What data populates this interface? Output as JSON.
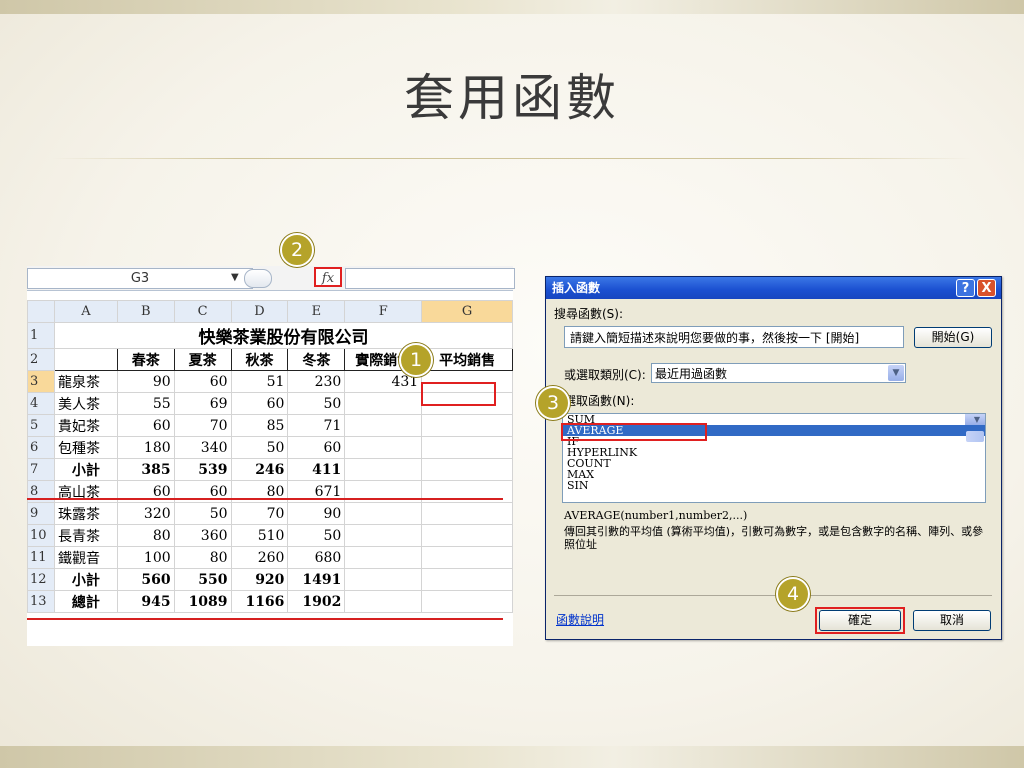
{
  "slide": {
    "title": "套用函數",
    "badges": [
      "1",
      "2",
      "3",
      "4"
    ]
  },
  "spreadsheet": {
    "name_box": "G3",
    "fx_label": "fx",
    "columns": [
      "A",
      "B",
      "C",
      "D",
      "E",
      "F",
      "G"
    ],
    "row_numbers": [
      "1",
      "2",
      "3",
      "4",
      "5",
      "6",
      "7",
      "8",
      "9",
      "10",
      "11",
      "12",
      "13"
    ],
    "company_title": "快樂茶業股份有限公司",
    "headers": [
      "",
      "春茶",
      "夏茶",
      "秋茶",
      "冬茶",
      "實際銷售",
      "平均銷售"
    ],
    "rows": [
      [
        "龍泉茶",
        "90",
        "60",
        "51",
        "230",
        "431",
        ""
      ],
      [
        "美人茶",
        "55",
        "69",
        "60",
        "50",
        "",
        ""
      ],
      [
        "貴妃茶",
        "60",
        "70",
        "85",
        "71",
        "",
        ""
      ],
      [
        "包種茶",
        "180",
        "340",
        "50",
        "60",
        "",
        ""
      ],
      [
        "小計",
        "385",
        "539",
        "246",
        "411",
        "",
        ""
      ],
      [
        "高山茶",
        "60",
        "60",
        "80",
        "671",
        "",
        ""
      ],
      [
        "珠露茶",
        "320",
        "50",
        "70",
        "90",
        "",
        ""
      ],
      [
        "長青茶",
        "80",
        "360",
        "510",
        "50",
        "",
        ""
      ],
      [
        "鐵觀音",
        "100",
        "80",
        "260",
        "680",
        "",
        ""
      ],
      [
        "小計",
        "560",
        "550",
        "920",
        "1491",
        "",
        ""
      ],
      [
        "總計",
        "945",
        "1089",
        "1166",
        "1902",
        "",
        ""
      ]
    ]
  },
  "dialog": {
    "title": "插入函數",
    "help_btn": "?",
    "close_btn": "X",
    "search_label": "搜尋函數(S):",
    "search_value": "請鍵入簡短描述來說明您要做的事，然後按一下 [開始]",
    "go_button": "開始(G)",
    "category_label": "或選取類別(C):",
    "category_value": "最近用過函數",
    "select_label": "選取函數(N):",
    "functions": [
      "SUM",
      "AVERAGE",
      "IF",
      "HYPERLINK",
      "COUNT",
      "MAX",
      "SIN"
    ],
    "selected_index": 1,
    "signature": "AVERAGE(number1,number2,...)",
    "description": "傳回其引數的平均值 (算術平均值)，引數可為數字，或是包含數字的名稱、陣列、或參照位址",
    "help_link": "函數說明",
    "ok_button": "確定",
    "cancel_button": "取消"
  },
  "colors": {
    "highlight_red": "#e02020",
    "badge": "#b5a32a",
    "selection_blue": "#316ac5",
    "titlebar_blue": "#1a4fd0"
  }
}
